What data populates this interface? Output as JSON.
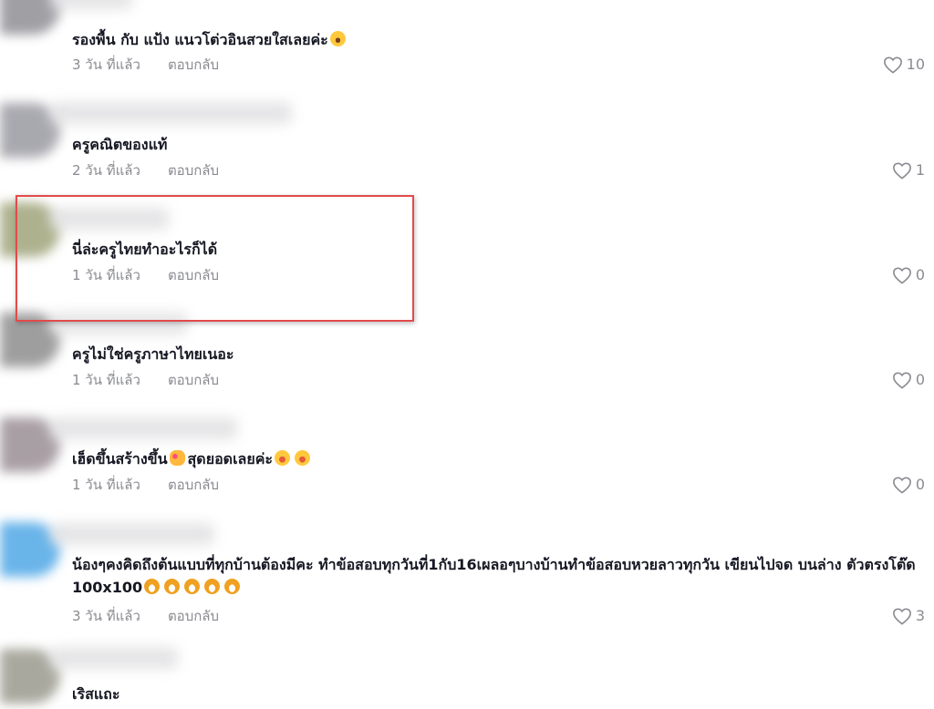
{
  "comments": [
    {
      "text": "รองพื้น กับ แป้ง แนวโต่วอินสวยใสเลยค่ะ",
      "emoji": [
        "sweat-smile"
      ],
      "time": "3 วัน ที่แล้ว",
      "reply": "ตอบกลับ",
      "likes": "10",
      "avatar_color": "#8f8f95"
    },
    {
      "text": "ครูคณิตของแท้",
      "emoji": [],
      "time": "2 วัน ที่แล้ว",
      "reply": "ตอบกลับ",
      "likes": "1",
      "avatar_color": "#9a9aa2"
    },
    {
      "text": "นี่ล่ะครูไทยทำอะไรก็ได้",
      "emoji": [],
      "time": "1 วัน ที่แล้ว",
      "reply": "ตอบกลับ",
      "likes": "0",
      "avatar_color": "#9fa47a"
    },
    {
      "text": "ครูไม่ใช่ครูภาษาไทยเนอะ",
      "emoji": [],
      "time": "1 วัน ที่แล้ว",
      "reply": "ตอบกลับ",
      "likes": "0",
      "avatar_color": "#8e8e8e"
    },
    {
      "text": "เฮ็ดขึ้นสร้างขึ้น",
      "text_after": "สุดยอดเลยค่ะ",
      "emoji": [
        "smiling-face-with-hearts",
        "laughing",
        "laughing"
      ],
      "time": "1 วัน ที่แล้ว",
      "reply": "ตอบกลับ",
      "likes": "0",
      "avatar_color": "#9a8f95"
    },
    {
      "text": "น้องๆคงคิดถึงต้นแบบที่ทุกบ้านต้องมีคะ ทำข้อสอบทุกวันที่1กับ16เผลอๆบางบ้านทำข้อสอบหวยลาวทุกวัน เขียนไปจด บนล่าง ตัวตรงโต๊ด 100x100",
      "emoji": [
        "grinning",
        "grinning",
        "grinning",
        "grinning",
        "grinning"
      ],
      "time": "3 วัน ที่แล้ว",
      "reply": "ตอบกลับ",
      "likes": "3",
      "avatar_color": "#4fa7e6"
    },
    {
      "text": "เริสแถะ",
      "emoji": [],
      "avatar_color": "#9a9a8e"
    }
  ],
  "icons": {
    "like": "heart-outline-icon"
  },
  "colors": {
    "highlight": "#e24b4b",
    "meta_text": "#8a8b91"
  }
}
